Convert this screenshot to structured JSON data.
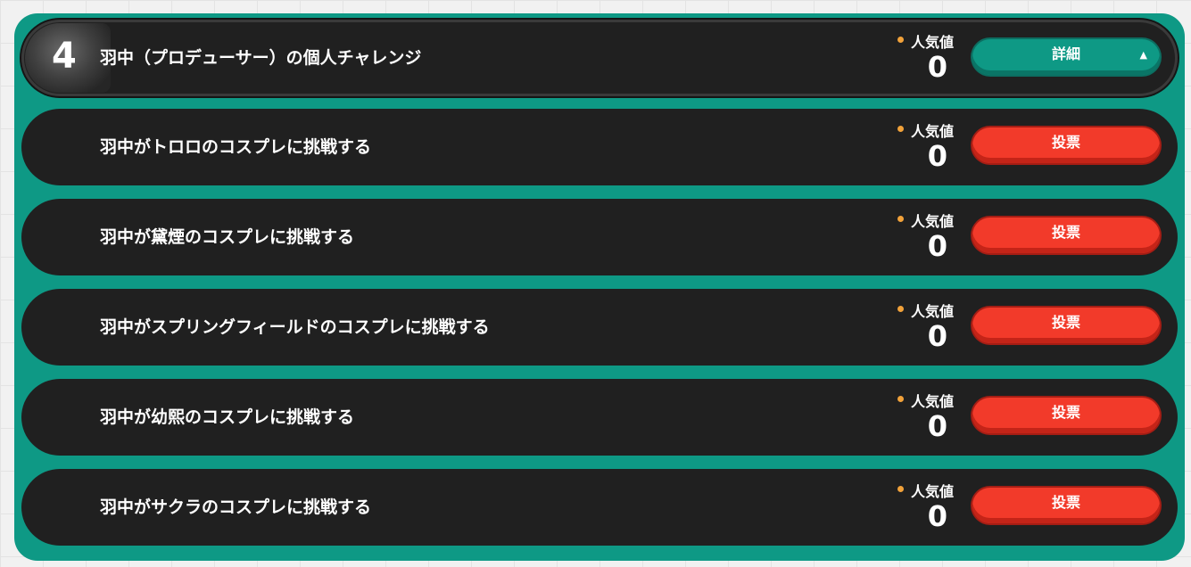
{
  "header": {
    "rank": "4",
    "title": "羽中（プロデューサー）の個人チャレンジ",
    "popularity_label": "人気値",
    "popularity_value": "0",
    "detail_label": "詳細",
    "detail_icon": "▲"
  },
  "challenges": [
    {
      "title": "羽中がトロロのコスプレに挑戦する",
      "popularity_label": "人気値",
      "popularity_value": "0",
      "vote_label": "投票"
    },
    {
      "title": "羽中が黛煙のコスプレに挑戦する",
      "popularity_label": "人気値",
      "popularity_value": "0",
      "vote_label": "投票"
    },
    {
      "title": "羽中がスプリングフィールドのコスプレに挑戦する",
      "popularity_label": "人気値",
      "popularity_value": "0",
      "vote_label": "投票"
    },
    {
      "title": "羽中が幼熙のコスプレに挑戦する",
      "popularity_label": "人気値",
      "popularity_value": "0",
      "vote_label": "投票"
    },
    {
      "title": "羽中がサクラのコスプレに挑戦する",
      "popularity_label": "人気値",
      "popularity_value": "0",
      "vote_label": "投票"
    }
  ],
  "colors": {
    "panel": "#0e9985",
    "row": "#202020",
    "vote_button": "#f23a2a",
    "detail_button": "#0e9985",
    "dot": "#f2a23a"
  }
}
